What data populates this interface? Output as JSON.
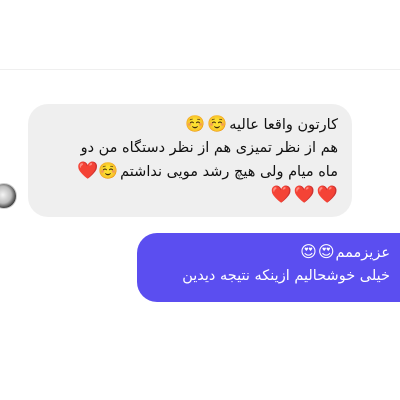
{
  "conversation": {
    "received_message": {
      "lines": [
        "کارتون واقعا عالیه",
        "هم از نظر تمیزی هم از نظر دستگاه من دو",
        "ماه میام ولی هیچ رشد مویی نداشتم"
      ],
      "emoji": {
        "smile": "☺️",
        "heart": "❤️"
      }
    },
    "sent_message": {
      "lines": [
        "عزیزممم",
        "خیلی خوشحالیم ازینکه نتیجه دیدین"
      ],
      "emoji": {
        "heart_eyes": "😍"
      }
    }
  },
  "colors": {
    "received_bubble": "#efefef",
    "sent_bubble": "#5b4ef0",
    "heart": "#e0242b"
  },
  "icons": [
    "avatar",
    "smiling-face-icon",
    "red-heart-icon",
    "heart-eyes-icon"
  ]
}
